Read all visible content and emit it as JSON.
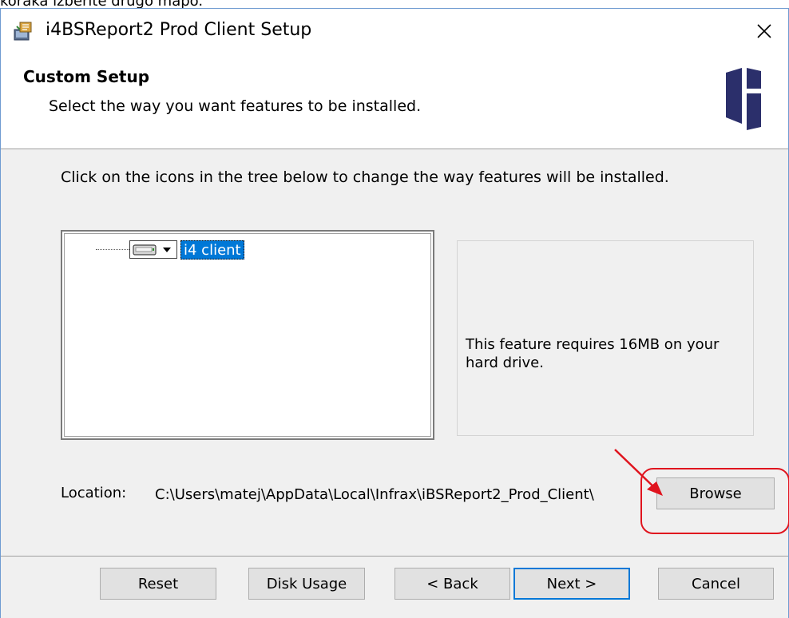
{
  "top_caption": "koraka izberite drugo mapo.",
  "window": {
    "title": "i4BSReport2 Prod Client Setup",
    "app_icon": "installer-icon",
    "close_icon": "close-icon"
  },
  "header": {
    "title": "Custom Setup",
    "subtitle": "Select the way you want features to be installed.",
    "logo": "i4-logo"
  },
  "instruction": "Click on the icons in the tree below to change the way features will be installed.",
  "tree": {
    "items": [
      {
        "label": "i4 client",
        "icon": "hard-drive-icon",
        "selected": true
      }
    ]
  },
  "description": {
    "text": "This feature requires 16MB on your hard drive."
  },
  "location": {
    "label": "Location:",
    "path": "C:\\Users\\matej\\AppData\\Local\\Infrax\\iBSReport2_Prod_Client\\"
  },
  "buttons": {
    "browse": "Browse",
    "reset": "Reset",
    "disk_usage": "Disk Usage",
    "back": "< Back",
    "next": "Next >",
    "cancel": "Cancel"
  },
  "colors": {
    "selection": "#0078d7",
    "annotation": "#e0141e",
    "logo": "#2b2f6b"
  }
}
